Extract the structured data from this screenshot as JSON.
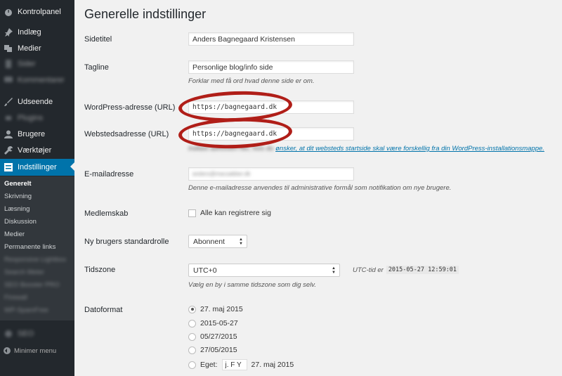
{
  "sidebar": {
    "menu": [
      {
        "label": "Kontrolpanel",
        "icon": "dashboard-icon"
      },
      {
        "label": "Indlæg",
        "icon": "pin-icon"
      },
      {
        "label": "Medier",
        "icon": "media-icon"
      },
      {
        "label": "Sider",
        "icon": "page-icon"
      },
      {
        "label": "Kommentarer",
        "icon": "comment-icon"
      },
      {
        "label": "Udseende",
        "icon": "brush-icon"
      },
      {
        "label": "Plugins",
        "icon": "plugin-icon"
      },
      {
        "label": "Brugere",
        "icon": "user-icon"
      },
      {
        "label": "Værktøjer",
        "icon": "wrench-icon"
      },
      {
        "label": "Indstillinger",
        "icon": "settings-icon"
      }
    ],
    "submenu": [
      "Generelt",
      "Skrivning",
      "Læsning",
      "Diskussion",
      "Medier",
      "Permanente links",
      "Responsive Lightbox",
      "Search Meter",
      "SEO Booster PRO",
      "Firewall",
      "WP-SpamFree"
    ],
    "extra_item": "SEO",
    "collapse_label": "Minimer menu"
  },
  "page": {
    "title": "Generelle indstillinger",
    "site_title": {
      "label": "Sidetitel",
      "value": "Anders Bagnegaard Kristensen"
    },
    "tagline": {
      "label": "Tagline",
      "value": "Personlige blog/info side",
      "description": "Forklar med få ord hvad denne side er om."
    },
    "wp_url": {
      "label": "WordPress-adresse (URL)",
      "value": "https://bagnegaard.dk"
    },
    "site_url": {
      "label": "Webstedsadresse (URL)",
      "value": "https://bagnegaard.dk",
      "description_prefix": "Indtast adressen her, hvis du ",
      "description_link": "ønsker, at dit websteds startside skal være forskellig fra din WordPress-installationsmappe."
    },
    "email": {
      "label": "E-mailadresse",
      "value": "anders@macsabber.dk",
      "description": "Denne e-mailadresse anvendes til administrative formål som notifikation om nye brugere."
    },
    "membership": {
      "label": "Medlemskab",
      "checkbox_label": "Alle kan registrere sig"
    },
    "default_role": {
      "label": "Ny brugers standardrolle",
      "value": "Abonnent"
    },
    "timezone": {
      "label": "Tidszone",
      "value": "UTC+0",
      "utc_label": "UTC-tid er",
      "utc_time": "2015-05-27 12:59:01",
      "description": "Vælg en by i samme tidszone som dig selv."
    },
    "date_format": {
      "label": "Datoformat",
      "options": [
        "27. maj 2015",
        "2015-05-27",
        "05/27/2015",
        "27/05/2015"
      ],
      "custom_label": "Eget:",
      "custom_value": "j. F Y",
      "custom_preview": "27. maj 2015"
    }
  },
  "colors": {
    "sidebar_bg": "#23282d",
    "accent": "#0073aa",
    "highlight_ellipse": "#b01e18"
  }
}
